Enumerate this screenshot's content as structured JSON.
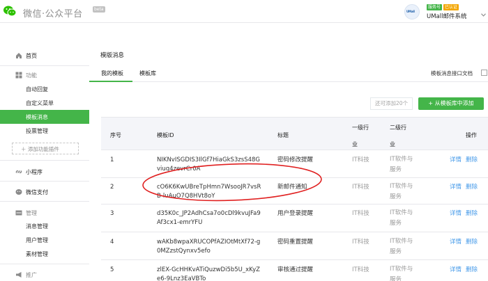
{
  "topbar": {
    "brand": "微信·公众平台",
    "beta": "beta",
    "account": {
      "avatar_text": "UMall",
      "badge_service": "服务号",
      "badge_verified": "已认证",
      "name": "UMall邮件系统",
      "menu_icon": "chevron-down-icon"
    }
  },
  "sidebar": {
    "home": "首页",
    "function": {
      "title": "功能",
      "items": [
        "自动回复",
        "自定义菜单",
        "模板消息",
        "投票管理"
      ],
      "active_index": 2,
      "add_plugin": "添加功能插件"
    },
    "mini_program": "小程序",
    "wechat_pay": "微信支付",
    "management": {
      "title": "管理",
      "items": [
        "消息管理",
        "用户管理",
        "素材管理"
      ]
    },
    "promotion": "推广"
  },
  "main": {
    "title": "模版消息",
    "tabs": [
      "我的模板",
      "模板库"
    ],
    "active_tab": 0,
    "doc_link": "模板消息接口文档",
    "limit_button": "还可添加20个",
    "add_button": "从模板库中添加",
    "table": {
      "headers": {
        "idx": "序号",
        "id": "模板ID",
        "title": "标题",
        "ind1_a": "一级行",
        "ind1_b": "业",
        "ind2_a": "二级行",
        "ind2_b": "业",
        "ops": "操作"
      },
      "rows": [
        {
          "idx": "1",
          "id": "NIKNvISGDIS3IlGf7HiaGkS3zsS48Gviuq4zevrCr0A",
          "title": "密码修改提醒",
          "ind1": "IT科技",
          "ind2": "IT软件与服务",
          "detail": "详情",
          "delete": "删除"
        },
        {
          "idx": "2",
          "id": "cO6K6KwUBreTpHmn7WsooJR7vsRB-luAuO7Q8HVt8oY",
          "title": "新邮件通知",
          "ind1": "IT科技",
          "ind2": "IT软件与服务",
          "detail": "详情",
          "delete": "删除"
        },
        {
          "idx": "3",
          "id": "d35K0c_JP2AdhCsa7o0cDl9kvuJFa9Af3cx1-emrYFU",
          "title": "用户登录提醒",
          "ind1": "IT科技",
          "ind2": "IT软件与服务",
          "detail": "详情",
          "delete": "删除"
        },
        {
          "idx": "4",
          "id": "wAKb8wpaXRUCOPfAZIOtMtXf72-g0MZzstQynxv5efo",
          "title": "密码重置提醒",
          "ind1": "IT科技",
          "ind2": "IT软件与服务",
          "detail": "详情",
          "delete": "删除"
        },
        {
          "idx": "5",
          "id": "zlEX-GcHHKvATiQuzwDi5b5U_xKyZe6-9Lnz3EaVBTo",
          "title": "审核通过提醒",
          "ind1": "IT科技",
          "ind2": "IT软件与服务",
          "detail": "详情",
          "delete": "删除"
        }
      ]
    }
  },
  "colors": {
    "accent": "#44b549",
    "link": "#459ae9",
    "annotation": "#e02020"
  }
}
